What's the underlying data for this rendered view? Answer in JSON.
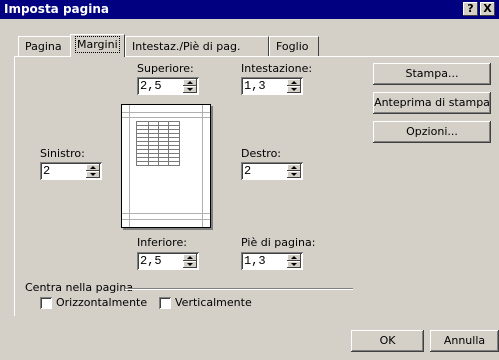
{
  "window": {
    "title": "Imposta pagina",
    "help_button": "?",
    "close_button": "X"
  },
  "tabs": [
    {
      "label": "Pagina",
      "active": false
    },
    {
      "label": "Margini",
      "active": true
    },
    {
      "label": "Intestaz./Piè di pag.",
      "active": false
    },
    {
      "label": "Foglio",
      "active": false
    }
  ],
  "margins": {
    "superiore": {
      "label": "Superiore:",
      "value": "2,5"
    },
    "intestazione": {
      "label": "Intestazione:",
      "value": "1,3"
    },
    "sinistro": {
      "label": "Sinistro:",
      "value": "2"
    },
    "destro": {
      "label": "Destro:",
      "value": "2"
    },
    "inferiore": {
      "label": "Inferiore:",
      "value": "2,5"
    },
    "pie_di_pagina": {
      "label": "Piè di pagina:",
      "value": "1,3"
    }
  },
  "side_buttons": {
    "stampa": "Stampa...",
    "anteprima": "Anteprima di stampa",
    "opzioni": "Opzioni..."
  },
  "center_group": {
    "title": "Centra nella pagina",
    "orizzontalmente": {
      "label": "Orizzontalmente",
      "checked": false
    },
    "verticalmente": {
      "label": "Verticalmente",
      "checked": false
    }
  },
  "footer": {
    "ok": "OK",
    "cancel": "Annulla"
  }
}
